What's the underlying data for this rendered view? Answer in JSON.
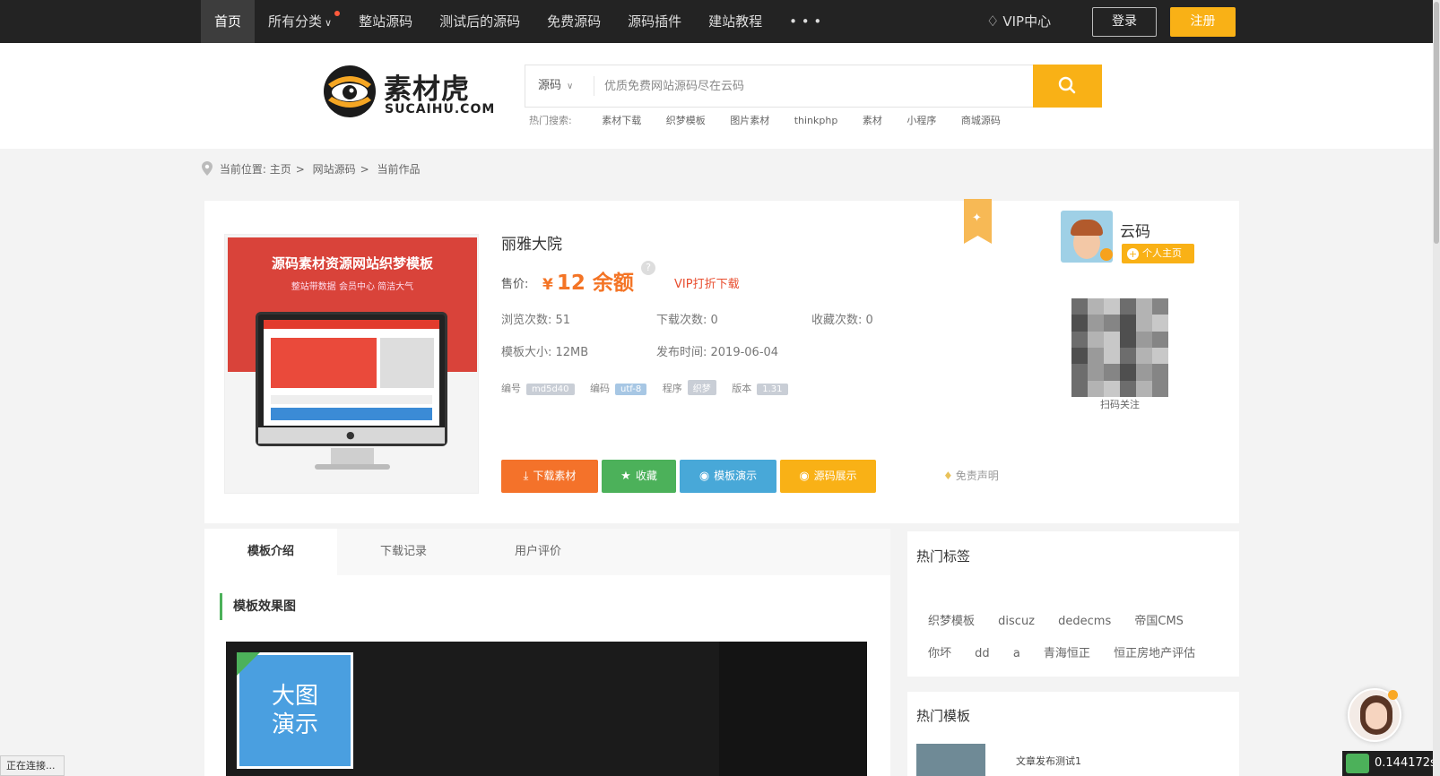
{
  "nav": {
    "items": [
      "首页",
      "所有分类",
      "整站源码",
      "测试后的源码",
      "免费源码",
      "源码插件",
      "建站教程",
      "• • •"
    ],
    "vip": "VIP中心",
    "login": "登录",
    "register": "注册"
  },
  "logo": {
    "cn": "素材虎",
    "en": "SUCAIHU.COM"
  },
  "search": {
    "category": "源码",
    "placeholder": "优质免费网站源码尽在云码",
    "hot_label": "热门搜索:",
    "hot": [
      "素材下载",
      "织梦模板",
      "图片素材",
      "thinkphp",
      "素材",
      "小程序",
      "商城源码"
    ]
  },
  "breadcrumb": {
    "prefix": "当前位置:",
    "items": [
      "主页",
      "网站源码",
      "当前作品"
    ]
  },
  "product": {
    "thumb_title": "源码素材资源网站织梦模板",
    "thumb_sub": "整站带数据 会员中心 简洁大气",
    "title": "丽雅大院",
    "price_label": "售价:",
    "currency": "¥",
    "price": "12 余额",
    "vip_link": "VIP打折下载",
    "stats": {
      "views": "浏览次数: 51",
      "downloads": "下载次数: 0",
      "favorites": "收藏次数: 0",
      "size": "模板大小: 12MB",
      "date": "发布时间: 2019-06-04"
    },
    "tags": [
      {
        "label": "编号",
        "value": "md5d40"
      },
      {
        "label": "编码",
        "value": "utf-8"
      },
      {
        "label": "程序",
        "value": "织梦"
      },
      {
        "label": "版本",
        "value": "1.31"
      }
    ],
    "buttons": {
      "download": "下载素材",
      "favorite": "收藏",
      "demo": "模板演示",
      "source": "源码展示"
    },
    "disclaimer": "免责声明"
  },
  "author": {
    "name": "云码",
    "home": "个人主页",
    "qr_caption": "扫码关注"
  },
  "tabs": [
    "模板介绍",
    "下载记录",
    "用户评价"
  ],
  "section_title": "模板效果图",
  "preview_button": "大图\n演示",
  "hot_tags": {
    "title": "热门标签",
    "items": [
      "织梦模板",
      "discuz",
      "dedecms",
      "帝国CMS",
      "你坏",
      "dd",
      "a",
      "青海恒正",
      "恒正房地产评估"
    ]
  },
  "hot_templates": {
    "title": "热门模板",
    "items": [
      "文章发布测试1"
    ]
  },
  "status": "正在连接...",
  "timer": "0.144172s",
  "colors": {
    "accent": "#f9b116",
    "price": "#f47425",
    "green": "#4cb15a",
    "blue": "#48a8d8",
    "orange": "#f4722a"
  }
}
